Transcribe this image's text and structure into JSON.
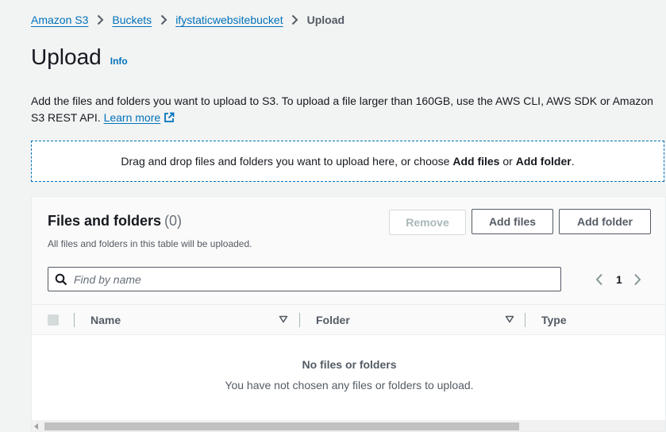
{
  "breadcrumb": {
    "items": [
      "Amazon S3",
      "Buckets",
      "ifystaticwebsitebucket"
    ],
    "current": "Upload"
  },
  "header": {
    "title": "Upload",
    "info_label": "Info"
  },
  "description": {
    "text": "Add the files and folders you want to upload to S3. To upload a file larger than 160GB, use the AWS CLI, AWS SDK or Amazon S3 REST API.",
    "learn_more": "Learn more"
  },
  "dropzone": {
    "prefix": "Drag and drop files and folders you want to upload here, or choose",
    "add_files": "Add files",
    "or": "or",
    "add_folder": "Add folder",
    "suffix": "."
  },
  "files_panel": {
    "title": "Files and folders",
    "count": "(0)",
    "subtitle": "All files and folders in this table will be uploaded.",
    "buttons": {
      "remove": "Remove",
      "add_files": "Add files",
      "add_folder": "Add folder"
    },
    "search": {
      "placeholder": "Find by name",
      "value": ""
    },
    "pagination": {
      "current_page": "1"
    },
    "table": {
      "columns": [
        "Name",
        "Folder",
        "Type"
      ]
    },
    "empty_state": {
      "title": "No files or folders",
      "message": "You have not chosen any files or folders to upload."
    }
  },
  "colors": {
    "background": "#f2f3f3",
    "link": "#0073bb",
    "text": "#16191f",
    "secondary_text": "#545b64",
    "disabled": "#aab7b8"
  },
  "icons": {
    "breadcrumb_separator": "chevron-right-icon",
    "external_link": "external-link-icon",
    "search": "search-icon",
    "prev_page": "chevron-left-icon",
    "next_page": "chevron-right-icon",
    "sort": "caret-down-icon",
    "scroll_left": "scroll-left-arrow-icon"
  }
}
